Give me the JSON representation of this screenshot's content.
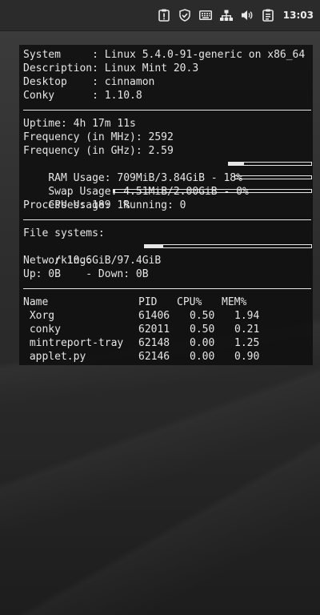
{
  "taskbar": {
    "clock": "13:03",
    "icons": [
      "update-manager-icon",
      "shield-icon",
      "keyboard-icon",
      "network-icon",
      "volume-icon",
      "clipboard-icon"
    ]
  },
  "conky": {
    "system": {
      "system_label": "System     :",
      "system_value": "Linux 5.4.0-91-generic on x86_64",
      "description_label": "Description:",
      "description_value": "Linux Mint 20.3",
      "desktop_label": "Desktop    :",
      "desktop_value": "cinnamon",
      "conky_label": "Conky      :",
      "conky_value": "1.10.8"
    },
    "stats": {
      "uptime": "Uptime: 4h 17m 11s",
      "freq_mhz": "Frequency (in MHz): 2592",
      "freq_ghz": "Frequency (in GHz): 2.59",
      "ram": "RAM Usage: 709MiB/3.84GiB - 18%",
      "ram_percent": 18,
      "swap": "Swap Usage: 4.51MiB/2.00GiB - 0%",
      "swap_percent": 0,
      "cpu": "CPU Usage: 1%",
      "cpu_percent": 1,
      "processes": "Processes: 189  Running: 0"
    },
    "filesystems": {
      "title": "File systems:",
      "root": " / 10.6GiB/97.4GiB",
      "root_percent": 11,
      "networking": "Networking:",
      "traffic": "Up: 0B    - Down: 0B"
    },
    "processes": {
      "headers": [
        "Name",
        "PID",
        "CPU%",
        "MEM%"
      ],
      "rows": [
        [
          " Xorg",
          "61406",
          "0.50",
          "1.94"
        ],
        [
          " conky",
          "62011",
          "0.50",
          "0.21"
        ],
        [
          " mintreport-tray",
          "62148",
          "0.00",
          "1.25"
        ],
        [
          " applet.py",
          "62146",
          "0.00",
          "0.90"
        ]
      ]
    }
  }
}
